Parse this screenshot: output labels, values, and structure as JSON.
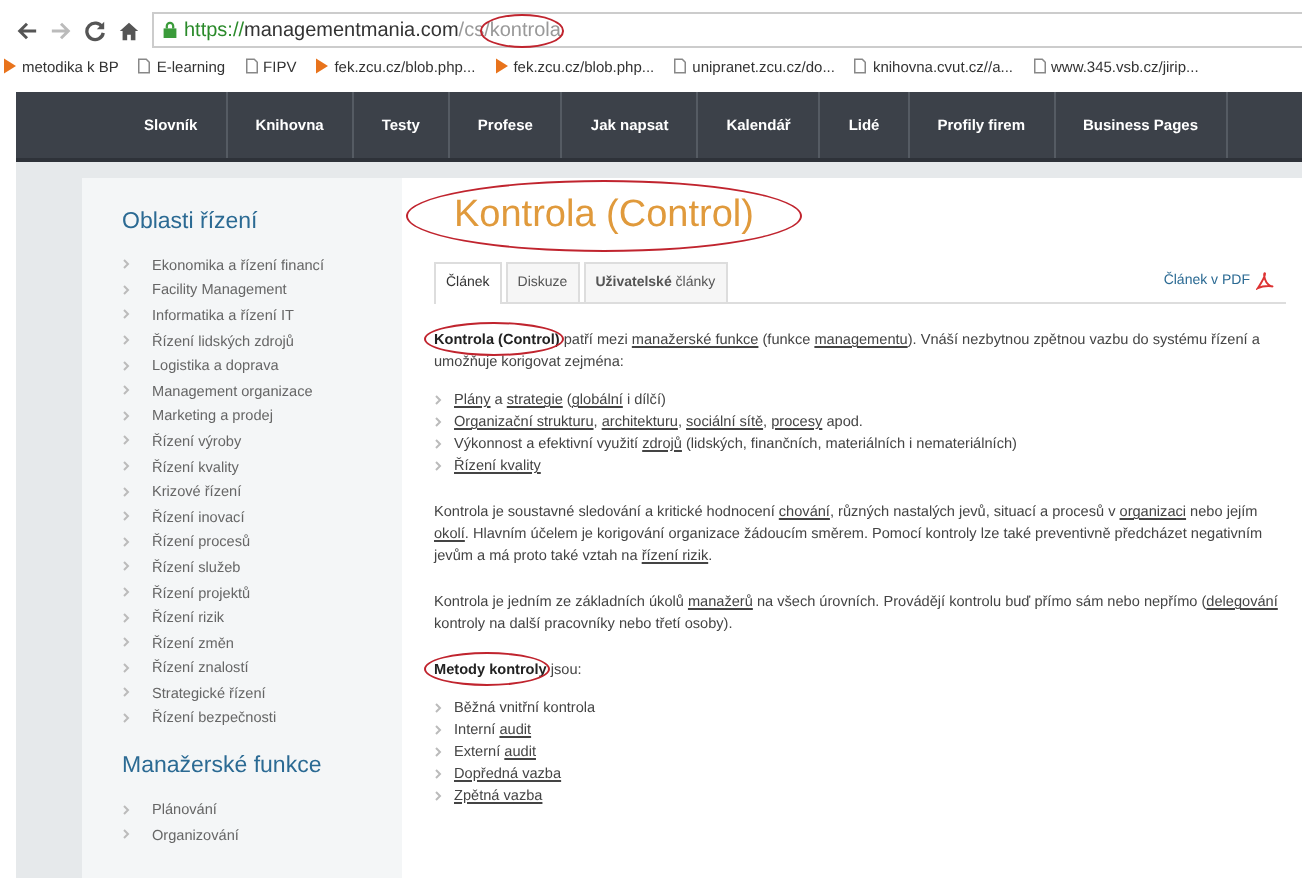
{
  "browser": {
    "url_host": "https://",
    "url_domain": "managementmania.com",
    "url_path": "/cs/",
    "url_slug": "kontrola",
    "bookmarks": [
      {
        "label": "metodika k BP",
        "kind": "play"
      },
      {
        "label": "E-learning",
        "kind": "page"
      },
      {
        "label": "FIPV",
        "kind": "page"
      },
      {
        "label": "fek.zcu.cz/blob.php...",
        "kind": "play"
      },
      {
        "label": "fek.zcu.cz/blob.php...",
        "kind": "play"
      },
      {
        "label": "unipranet.zcu.cz/do...",
        "kind": "page"
      },
      {
        "label": "knihovna.cvut.cz//a...",
        "kind": "page"
      },
      {
        "label": "www.345.vsb.cz/jirip...",
        "kind": "page"
      }
    ]
  },
  "nav": [
    "Slovník",
    "Knihovna",
    "Testy",
    "Profese",
    "Jak napsat",
    "Kalendář",
    "Lidé",
    "Profily firem",
    "Business Pages"
  ],
  "sidebar": [
    {
      "heading": "Oblasti řízení",
      "items": [
        "Ekonomika a řízení financí",
        "Facility Management",
        "Informatika a řízení IT",
        "Řízení lidských zdrojů",
        "Logistika a doprava",
        "Management organizace",
        "Marketing a prodej",
        "Řízení výroby",
        "Řízení kvality",
        "Krizové řízení",
        "Řízení inovací",
        "Řízení procesů",
        "Řízení služeb",
        "Řízení projektů",
        "Řízení rizik",
        "Řízení změn",
        "Řízení znalostí",
        "Strategické řízení",
        "Řízení bezpečnosti"
      ]
    },
    {
      "heading": "Manažerské funkce",
      "items": [
        "Plánování",
        "Organizování"
      ]
    }
  ],
  "article": {
    "title": "Kontrola (Control)",
    "tabs": [
      {
        "label": "Článek",
        "selected": true
      },
      {
        "label": "Diskuze",
        "selected": false
      },
      {
        "label": "**Uživatelské** články",
        "selected": false
      }
    ],
    "pdf_link": "Článek v PDF",
    "blocks": [
      {
        "kind": "paragraph",
        "segments": [
          {
            "text": "Kontrola (Control)",
            "kind": "circled"
          },
          {
            "text": " patří mezi ",
            "kind": "text"
          },
          {
            "text": "manažerské funkce",
            "kind": "link"
          },
          {
            "text": " (funkce ",
            "kind": "text"
          },
          {
            "text": "managementu",
            "kind": "link"
          },
          {
            "text": "). Vnáší nezbytnou zpětnou vazbu do systému řízení a umožňuje korigovat zejména:",
            "kind": "text"
          }
        ]
      },
      {
        "kind": "list",
        "items": [
          [
            {
              "text": "Plány",
              "kind": "link"
            },
            {
              "text": " a ",
              "kind": "text"
            },
            {
              "text": "strategie",
              "kind": "link"
            },
            {
              "text": " (",
              "kind": "text"
            },
            {
              "text": "globální",
              "kind": "link"
            },
            {
              "text": " i dílčí)",
              "kind": "text"
            }
          ],
          [
            {
              "text": "Organizační strukturu",
              "kind": "link"
            },
            {
              "text": ", ",
              "kind": "text"
            },
            {
              "text": "architekturu",
              "kind": "link"
            },
            {
              "text": ", ",
              "kind": "text"
            },
            {
              "text": "sociální sítě",
              "kind": "link"
            },
            {
              "text": ", ",
              "kind": "text"
            },
            {
              "text": "procesy",
              "kind": "link"
            },
            {
              "text": " apod.",
              "kind": "text"
            }
          ],
          [
            {
              "text": "Výkonnost a efektivní využití ",
              "kind": "text"
            },
            {
              "text": "zdrojů",
              "kind": "link"
            },
            {
              "text": " (lidských, finančních, materiálních i nemateriálních)",
              "kind": "text"
            }
          ],
          [
            {
              "text": "Řízení kvality",
              "kind": "link"
            }
          ]
        ]
      },
      {
        "kind": "paragraph",
        "segments": [
          {
            "text": "Kontrola je soustavné sledování a kritické hodnocení ",
            "kind": "text"
          },
          {
            "text": "chování",
            "kind": "link"
          },
          {
            "text": ", různých nastalých jevů, situací a procesů v ",
            "kind": "text"
          },
          {
            "text": "organizaci",
            "kind": "link"
          },
          {
            "text": " nebo jejím ",
            "kind": "text"
          },
          {
            "text": "okolí",
            "kind": "link"
          },
          {
            "text": ".  Hlavním účelem je korigování organizace žádoucím směrem. Pomocí kontroly lze také preventivně předcházet negativním jevům a má proto také vztah na ",
            "kind": "text"
          },
          {
            "text": "řízení rizik",
            "kind": "link"
          },
          {
            "text": ".",
            "kind": "text"
          }
        ]
      },
      {
        "kind": "paragraph",
        "segments": [
          {
            "text": "Kontrola je jedním ze základních úkolů ",
            "kind": "text"
          },
          {
            "text": "manažerů",
            "kind": "link"
          },
          {
            "text": " na všech úrovních. Provádějí kontrolu buď přímo sám nebo nepřímo (",
            "kind": "text"
          },
          {
            "text": "delegování",
            "kind": "link"
          },
          {
            "text": " kontroly na další pracovníky nebo třetí osoby).",
            "kind": "text"
          }
        ]
      },
      {
        "kind": "paragraph",
        "segments": [
          {
            "text": "Metody kontroly",
            "kind": "circled"
          },
          {
            "text": " jsou:",
            "kind": "text"
          }
        ]
      },
      {
        "kind": "list",
        "items": [
          [
            {
              "text": "Běžná vnitřní kontrola",
              "kind": "text"
            }
          ],
          [
            {
              "text": "Interní ",
              "kind": "text"
            },
            {
              "text": "audit",
              "kind": "link"
            }
          ],
          [
            {
              "text": "Externí ",
              "kind": "text"
            },
            {
              "text": "audit",
              "kind": "link"
            }
          ],
          [
            {
              "text": "Dopředná vazba",
              "kind": "link"
            }
          ],
          [
            {
              "text": "Zpětná vazba",
              "kind": "link"
            }
          ]
        ]
      }
    ]
  }
}
